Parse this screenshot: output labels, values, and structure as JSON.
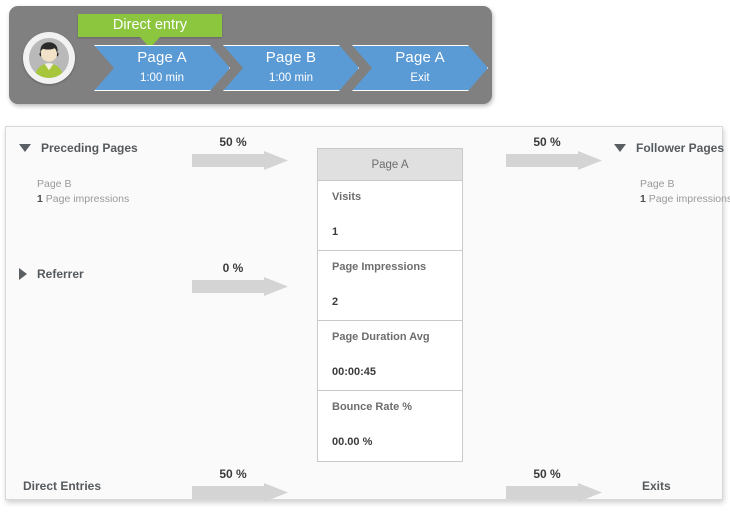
{
  "journey": {
    "direct_entry_label": "Direct entry",
    "avatar_icon": "user-avatar-icon",
    "steps": [
      {
        "title": "Page A",
        "sub": "1:00 min"
      },
      {
        "title": "Page B",
        "sub": "1:00 min"
      },
      {
        "title": "Page A",
        "sub": "Exit"
      }
    ]
  },
  "panel": {
    "preceding": {
      "header": "Preceding Pages",
      "toggle_icon": "triangle-down-icon",
      "page_name": "Page B",
      "count": "1",
      "count_unit": "Page impressions"
    },
    "referrer": {
      "header": "Referrer",
      "toggle_icon": "triangle-right-icon"
    },
    "follower": {
      "header": "Follower Pages",
      "toggle_icon": "triangle-down-icon",
      "page_name": "Page B",
      "count": "1",
      "count_unit": "Page impressions"
    },
    "direct_entries_label": "Direct Entries",
    "exits_label": "Exits"
  },
  "meters": {
    "preceding": {
      "pct_label": "50 %",
      "pct": 50,
      "color": "#8cbe12"
    },
    "referrer": {
      "pct_label": "0 %",
      "pct": 0,
      "color": "#8cbe12"
    },
    "follower": {
      "pct_label": "50 %",
      "pct": 50,
      "color": "#8cbe12"
    },
    "direct": {
      "pct_label": "50 %",
      "pct": 50,
      "color": "#8cbe12"
    },
    "exits": {
      "pct_label": "50 %",
      "pct": 50,
      "color": "#b01717"
    }
  },
  "metric_table": {
    "header": "Page A",
    "rows": [
      {
        "label": "Visits",
        "value": "1"
      },
      {
        "label": "Page Impressions",
        "value": "2"
      },
      {
        "label": "Page Duration Avg",
        "value": "00:00:45"
      },
      {
        "label": "Bounce Rate %",
        "value": "00.00 %"
      }
    ]
  },
  "colors": {
    "accent_green": "#8cbe12",
    "badge_green": "#8cc63e",
    "accent_red": "#b01717",
    "chevron_blue": "#5b9bd5",
    "bar_gray": "#808080"
  }
}
